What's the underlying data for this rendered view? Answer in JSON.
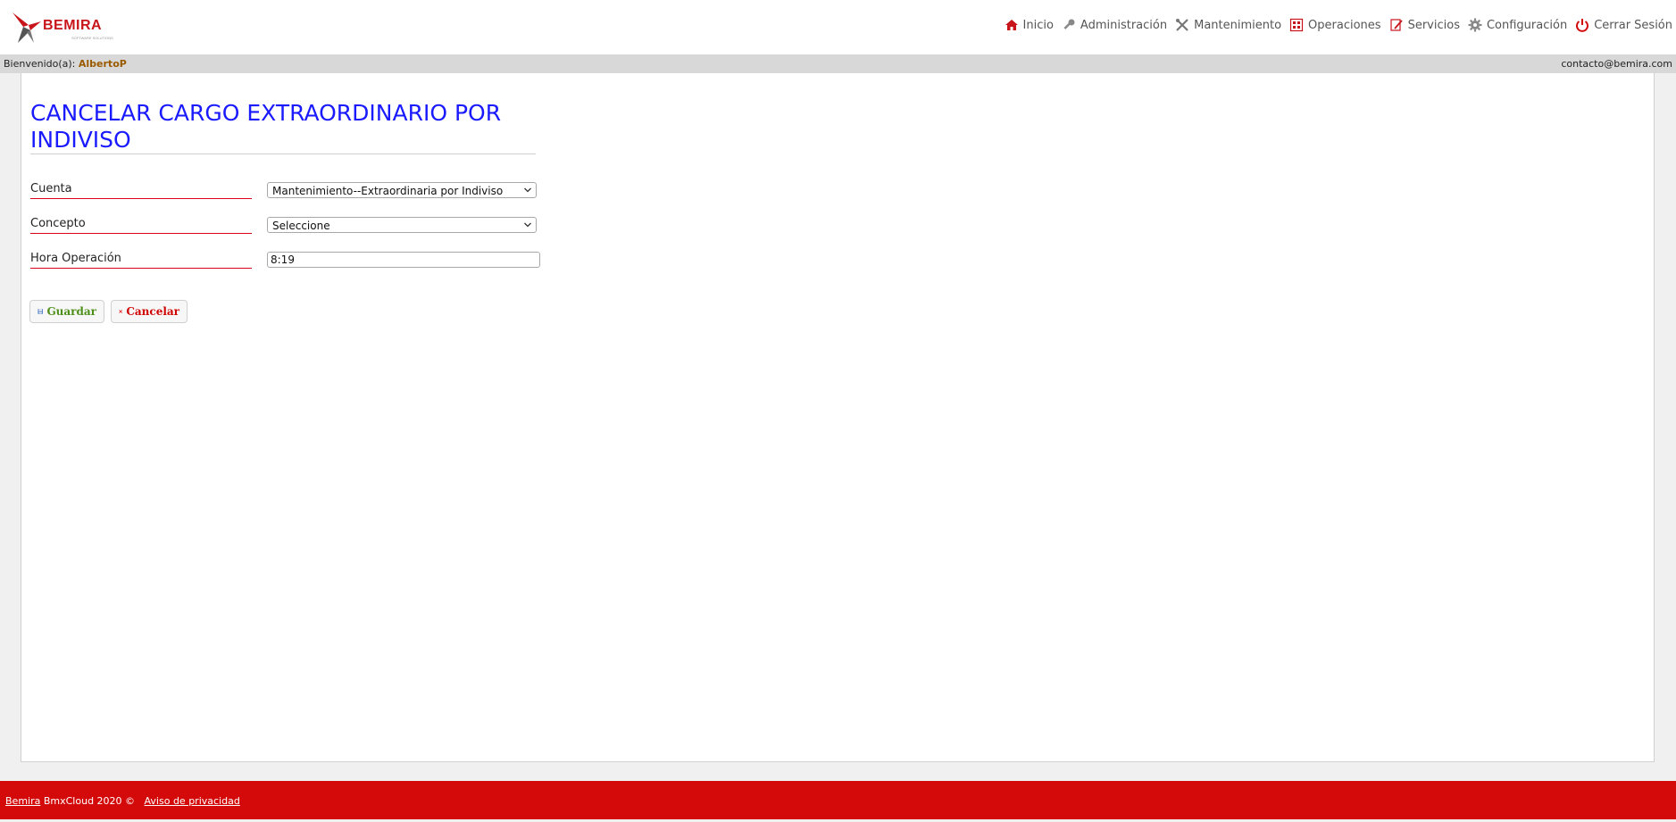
{
  "header": {
    "logo_text": "BEMIRA",
    "logo_subtitle": "SOFTWARE SOLUTIONS",
    "nav": [
      {
        "label": "Inicio",
        "icon": "home-icon"
      },
      {
        "label": "Administración",
        "icon": "key-icon"
      },
      {
        "label": "Mantenimiento",
        "icon": "tools-icon"
      },
      {
        "label": "Operaciones",
        "icon": "calculator-icon"
      },
      {
        "label": "Servicios",
        "icon": "edit-document-icon"
      },
      {
        "label": "Configuración",
        "icon": "gear-icon"
      },
      {
        "label": "Cerrar Sesión",
        "icon": "power-icon"
      }
    ]
  },
  "welcome": {
    "label": "Bienvenido(a):",
    "user": "AlbertoP",
    "email": "contacto@bemira.com"
  },
  "page": {
    "title": "CANCELAR CARGO EXTRAORDINARIO POR INDIVISO"
  },
  "form": {
    "cuenta": {
      "label": "Cuenta",
      "value": "Mantenimiento--Extraordinaria por Indiviso"
    },
    "concepto": {
      "label": "Concepto",
      "value": "Seleccione"
    },
    "hora": {
      "label": "Hora Operación",
      "value": "8:19"
    }
  },
  "buttons": {
    "save": "Guardar",
    "cancel": "Cancelar"
  },
  "footer": {
    "brand_link": "Bemira",
    "copyright": "BmxCloud 2020 ©",
    "privacy_link": "Aviso de privacidad"
  },
  "colors": {
    "accent_red": "#d40a0a",
    "title_blue": "#1a1aff",
    "user_brown": "#9a5b00",
    "save_green": "#4e8f1a"
  }
}
